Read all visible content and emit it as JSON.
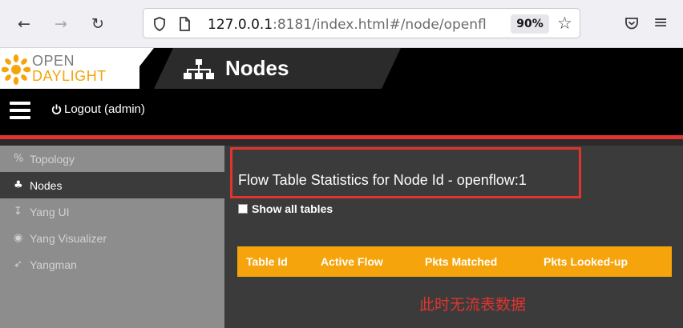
{
  "browser": {
    "url_host": "127.0.0.1",
    "url_rest": ":8181/index.html#/node/openfl",
    "zoom": "90%",
    "back_icon": "←",
    "forward_icon": "→",
    "reload_icon": "↻",
    "bookmark_icon": "☆",
    "pocket_icon": "♡",
    "menu_icon": "≡"
  },
  "header": {
    "logo_line1": "OPEN",
    "logo_line2": "DAYLIGHT",
    "title": "Nodes",
    "logout_label": "Logout (admin)"
  },
  "sidebar": {
    "items": [
      {
        "label": "Topology",
        "icon": "%"
      },
      {
        "label": "Nodes",
        "icon": "♣"
      },
      {
        "label": "Yang UI",
        "icon": "↧"
      },
      {
        "label": "Yang Visualizer",
        "icon": "◉"
      },
      {
        "label": "Yangman",
        "icon": "➶"
      }
    ]
  },
  "main": {
    "title": "Flow Table Statistics for Node Id - openflow:1",
    "show_all_label": "Show all tables",
    "table_headers": [
      "Table Id",
      "Active Flow",
      "Pkts Matched",
      "Pkts Looked-up"
    ],
    "empty_note": "此时无流表数据"
  },
  "colors": {
    "accent_orange": "#f5a40b",
    "accent_red": "#e1342f"
  }
}
